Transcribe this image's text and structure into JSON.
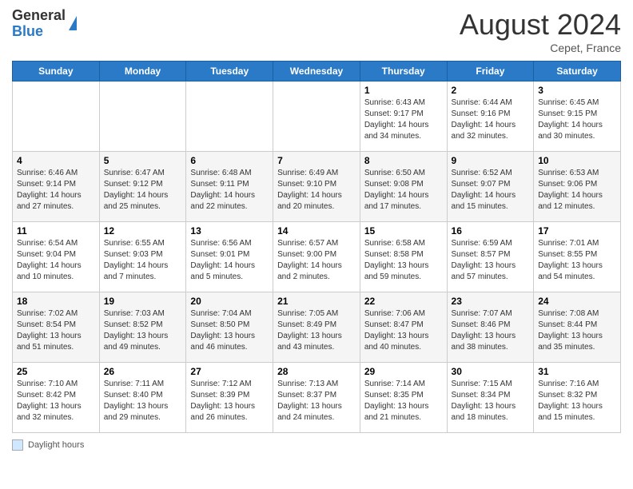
{
  "header": {
    "logo_general": "General",
    "logo_blue": "Blue",
    "month_title": "August 2024",
    "location": "Cepet, France"
  },
  "footer": {
    "label": "Daylight hours"
  },
  "calendar": {
    "days_of_week": [
      "Sunday",
      "Monday",
      "Tuesday",
      "Wednesday",
      "Thursday",
      "Friday",
      "Saturday"
    ],
    "weeks": [
      {
        "cells": [
          {
            "day": "",
            "info": ""
          },
          {
            "day": "",
            "info": ""
          },
          {
            "day": "",
            "info": ""
          },
          {
            "day": "",
            "info": ""
          },
          {
            "day": "1",
            "info": "Sunrise: 6:43 AM\nSunset: 9:17 PM\nDaylight: 14 hours\nand 34 minutes."
          },
          {
            "day": "2",
            "info": "Sunrise: 6:44 AM\nSunset: 9:16 PM\nDaylight: 14 hours\nand 32 minutes."
          },
          {
            "day": "3",
            "info": "Sunrise: 6:45 AM\nSunset: 9:15 PM\nDaylight: 14 hours\nand 30 minutes."
          }
        ]
      },
      {
        "cells": [
          {
            "day": "4",
            "info": "Sunrise: 6:46 AM\nSunset: 9:14 PM\nDaylight: 14 hours\nand 27 minutes."
          },
          {
            "day": "5",
            "info": "Sunrise: 6:47 AM\nSunset: 9:12 PM\nDaylight: 14 hours\nand 25 minutes."
          },
          {
            "day": "6",
            "info": "Sunrise: 6:48 AM\nSunset: 9:11 PM\nDaylight: 14 hours\nand 22 minutes."
          },
          {
            "day": "7",
            "info": "Sunrise: 6:49 AM\nSunset: 9:10 PM\nDaylight: 14 hours\nand 20 minutes."
          },
          {
            "day": "8",
            "info": "Sunrise: 6:50 AM\nSunset: 9:08 PM\nDaylight: 14 hours\nand 17 minutes."
          },
          {
            "day": "9",
            "info": "Sunrise: 6:52 AM\nSunset: 9:07 PM\nDaylight: 14 hours\nand 15 minutes."
          },
          {
            "day": "10",
            "info": "Sunrise: 6:53 AM\nSunset: 9:06 PM\nDaylight: 14 hours\nand 12 minutes."
          }
        ]
      },
      {
        "cells": [
          {
            "day": "11",
            "info": "Sunrise: 6:54 AM\nSunset: 9:04 PM\nDaylight: 14 hours\nand 10 minutes."
          },
          {
            "day": "12",
            "info": "Sunrise: 6:55 AM\nSunset: 9:03 PM\nDaylight: 14 hours\nand 7 minutes."
          },
          {
            "day": "13",
            "info": "Sunrise: 6:56 AM\nSunset: 9:01 PM\nDaylight: 14 hours\nand 5 minutes."
          },
          {
            "day": "14",
            "info": "Sunrise: 6:57 AM\nSunset: 9:00 PM\nDaylight: 14 hours\nand 2 minutes."
          },
          {
            "day": "15",
            "info": "Sunrise: 6:58 AM\nSunset: 8:58 PM\nDaylight: 13 hours\nand 59 minutes."
          },
          {
            "day": "16",
            "info": "Sunrise: 6:59 AM\nSunset: 8:57 PM\nDaylight: 13 hours\nand 57 minutes."
          },
          {
            "day": "17",
            "info": "Sunrise: 7:01 AM\nSunset: 8:55 PM\nDaylight: 13 hours\nand 54 minutes."
          }
        ]
      },
      {
        "cells": [
          {
            "day": "18",
            "info": "Sunrise: 7:02 AM\nSunset: 8:54 PM\nDaylight: 13 hours\nand 51 minutes."
          },
          {
            "day": "19",
            "info": "Sunrise: 7:03 AM\nSunset: 8:52 PM\nDaylight: 13 hours\nand 49 minutes."
          },
          {
            "day": "20",
            "info": "Sunrise: 7:04 AM\nSunset: 8:50 PM\nDaylight: 13 hours\nand 46 minutes."
          },
          {
            "day": "21",
            "info": "Sunrise: 7:05 AM\nSunset: 8:49 PM\nDaylight: 13 hours\nand 43 minutes."
          },
          {
            "day": "22",
            "info": "Sunrise: 7:06 AM\nSunset: 8:47 PM\nDaylight: 13 hours\nand 40 minutes."
          },
          {
            "day": "23",
            "info": "Sunrise: 7:07 AM\nSunset: 8:46 PM\nDaylight: 13 hours\nand 38 minutes."
          },
          {
            "day": "24",
            "info": "Sunrise: 7:08 AM\nSunset: 8:44 PM\nDaylight: 13 hours\nand 35 minutes."
          }
        ]
      },
      {
        "cells": [
          {
            "day": "25",
            "info": "Sunrise: 7:10 AM\nSunset: 8:42 PM\nDaylight: 13 hours\nand 32 minutes."
          },
          {
            "day": "26",
            "info": "Sunrise: 7:11 AM\nSunset: 8:40 PM\nDaylight: 13 hours\nand 29 minutes."
          },
          {
            "day": "27",
            "info": "Sunrise: 7:12 AM\nSunset: 8:39 PM\nDaylight: 13 hours\nand 26 minutes."
          },
          {
            "day": "28",
            "info": "Sunrise: 7:13 AM\nSunset: 8:37 PM\nDaylight: 13 hours\nand 24 minutes."
          },
          {
            "day": "29",
            "info": "Sunrise: 7:14 AM\nSunset: 8:35 PM\nDaylight: 13 hours\nand 21 minutes."
          },
          {
            "day": "30",
            "info": "Sunrise: 7:15 AM\nSunset: 8:34 PM\nDaylight: 13 hours\nand 18 minutes."
          },
          {
            "day": "31",
            "info": "Sunrise: 7:16 AM\nSunset: 8:32 PM\nDaylight: 13 hours\nand 15 minutes."
          }
        ]
      }
    ]
  }
}
